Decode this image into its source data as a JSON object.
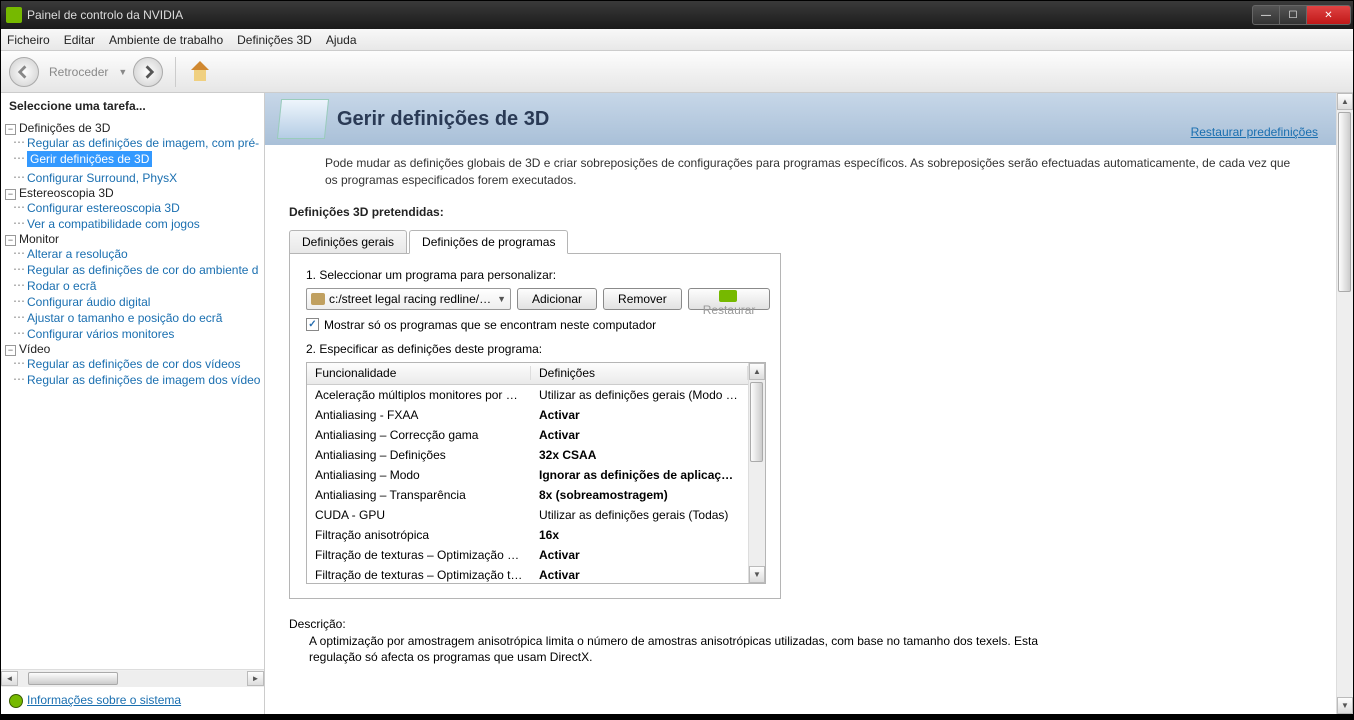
{
  "window": {
    "title": "Painel de controlo da NVIDIA"
  },
  "menu": {
    "file": "Ficheiro",
    "edit": "Editar",
    "desktop": "Ambiente de trabalho",
    "settings3d": "Definições 3D",
    "help": "Ajuda"
  },
  "toolbar": {
    "back": "Retroceder"
  },
  "sidebar": {
    "title": "Seleccione uma tarefa...",
    "groups": [
      {
        "label": "Definições de 3D",
        "items": [
          "Regular as definições de imagem, com pré-",
          "Gerir definições de 3D",
          "Configurar Surround, PhysX"
        ],
        "selectedIndex": 1
      },
      {
        "label": "Estereoscopia 3D",
        "items": [
          "Configurar estereoscopia 3D",
          "Ver a compatibilidade com jogos"
        ]
      },
      {
        "label": "Monitor",
        "items": [
          "Alterar a resolução",
          "Regular as definições de cor do ambiente d",
          "Rodar o ecrã",
          "Configurar áudio digital",
          "Ajustar o tamanho e posição do ecrã",
          "Configurar vários monitores"
        ]
      },
      {
        "label": "Vídeo",
        "items": [
          "Regular as definições de cor dos vídeos",
          "Regular as definições de imagem dos vídeo"
        ]
      }
    ],
    "systemInfo": "Informações sobre o sistema"
  },
  "page": {
    "title": "Gerir definições de 3D",
    "restore": "Restaurar predefinições",
    "intro": "Pode mudar as definições globais de 3D e criar sobreposições de configurações para programas específicos. As sobreposições serão efectuadas automaticamente, de cada vez que os programas especificados forem executados.",
    "sectionTitle": "Definições 3D pretendidas:",
    "tabs": {
      "global": "Definições gerais",
      "program": "Definições de programas"
    },
    "step1": "1. Seleccionar um programa para personalizar:",
    "program": "c:/street legal racing redline/slr...",
    "btnAdd": "Adicionar",
    "btnRemove": "Remover",
    "btnRestore": "Restaurar",
    "checkbox": "Mostrar só os programas que se encontram neste computador",
    "step2": "2. Especificar as definições deste programa:",
    "colFeature": "Funcionalidade",
    "colSetting": "Definições",
    "rows": [
      {
        "f": "Aceleração múltiplos monitores por combin...",
        "s": "Utilizar as definições gerais (Modo de dese...",
        "b": false
      },
      {
        "f": "Antialiasing - FXAA",
        "s": "Activar",
        "b": true
      },
      {
        "f": "Antialiasing – Correcção gama",
        "s": "Activar",
        "b": true
      },
      {
        "f": "Antialiasing – Definições",
        "s": "32x CSAA",
        "b": true
      },
      {
        "f": "Antialiasing – Modo",
        "s": "Ignorar as definições de aplicações",
        "b": true
      },
      {
        "f": "Antialiasing – Transparência",
        "s": "8x (sobreamostragem)",
        "b": true
      },
      {
        "f": "CUDA - GPU",
        "s": "Utilizar as definições gerais (Todas)",
        "b": false
      },
      {
        "f": "Filtração anisotrópica",
        "s": "16x",
        "b": true
      },
      {
        "f": "Filtração de texturas – Optimização por a...",
        "s": "Activar",
        "b": true
      },
      {
        "f": "Filtração de texturas – Optimização trilinear",
        "s": "Activar",
        "b": true
      }
    ],
    "descHead": "Descrição:",
    "descBody": "A optimização por amostragem anisotrópica limita o número de amostras anisotrópicas utilizadas, com base no tamanho dos texels. Esta regulação só afecta os programas que usam DirectX."
  }
}
